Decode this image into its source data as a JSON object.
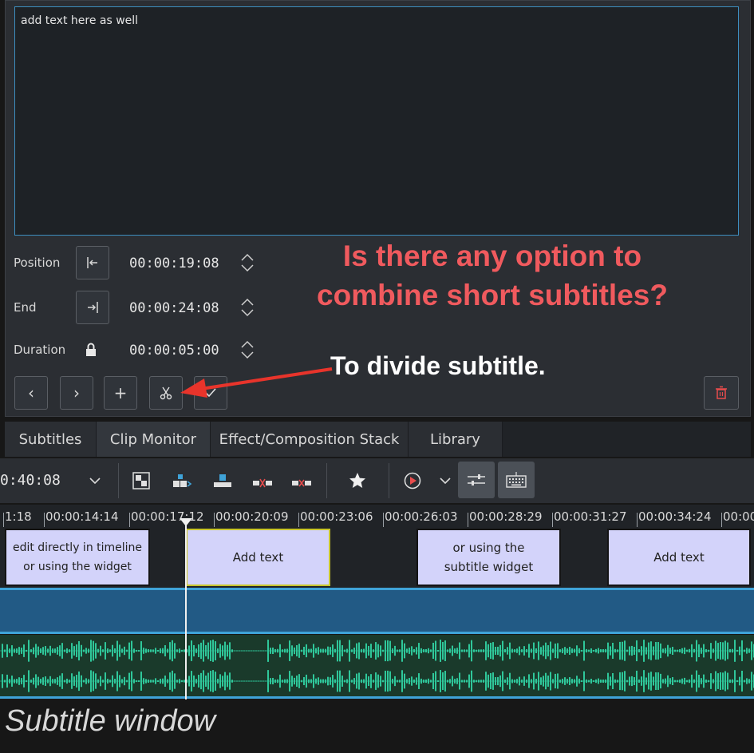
{
  "editor": {
    "text": "add text here as well",
    "position_label": "Position",
    "position_value": "00:00:19:08",
    "end_label": "End",
    "end_value": "00:00:24:08",
    "duration_label": "Duration",
    "duration_value": "00:00:05:00"
  },
  "annotations": {
    "question": "Is there any option to combine short subtitles?",
    "divide_note": "To divide subtitle."
  },
  "tabs": [
    "Subtitles",
    "Clip Monitor",
    "Effect/Composition Stack",
    "Library"
  ],
  "toolbar": {
    "timecode": "0:40:08"
  },
  "ruler": {
    "ticks": [
      "1:18",
      "00:00:14:14",
      "00:00:17:12",
      "00:00:20:09",
      "00:00:23:06",
      "00:00:26:03",
      "00:00:28:29",
      "00:00:31:27",
      "00:00:34:24",
      "00:00"
    ]
  },
  "subtitles": [
    "edit directly in timeline or using the widget",
    "Add text",
    "or using the subtitle widget",
    "Add text"
  ],
  "caption": "Subtitle window",
  "colors": {
    "annotation_red": "#f05a5e",
    "selection_border": "#3d8ebf",
    "subtitle_bg": "#d3d3fa",
    "video_track": "#225a85",
    "waveform": "#2fc79a"
  }
}
